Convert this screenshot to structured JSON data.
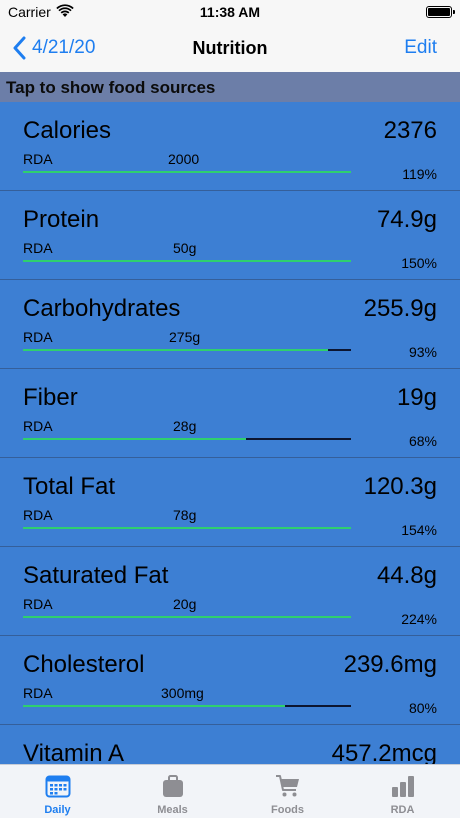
{
  "status_bar": {
    "carrier": "Carrier",
    "time": "11:38 AM"
  },
  "nav": {
    "back_label": "4/21/20",
    "title": "Nutrition",
    "edit_label": "Edit"
  },
  "section_header": "Tap to show food sources",
  "colors": {
    "accent": "#1e7ef0",
    "row_background": "#3d7fd3",
    "progress_fill": "#2fd06e",
    "progress_track": "#0c1530"
  },
  "nutrients": [
    {
      "name": "Calories",
      "amount": "2376",
      "rda_label": "RDA",
      "rda_value": "2000",
      "percent_label": "119%",
      "progress": 1.0
    },
    {
      "name": "Protein",
      "amount": "74.9g",
      "rda_label": "RDA",
      "rda_value": "50g",
      "percent_label": "150%",
      "progress": 1.0
    },
    {
      "name": "Carbohydrates",
      "amount": "255.9g",
      "rda_label": "RDA",
      "rda_value": "275g",
      "percent_label": "93%",
      "progress": 0.93
    },
    {
      "name": "Fiber",
      "amount": "19g",
      "rda_label": "RDA",
      "rda_value": "28g",
      "percent_label": "68%",
      "progress": 0.68
    },
    {
      "name": "Total Fat",
      "amount": "120.3g",
      "rda_label": "RDA",
      "rda_value": "78g",
      "percent_label": "154%",
      "progress": 1.0
    },
    {
      "name": "Saturated Fat",
      "amount": "44.8g",
      "rda_label": "RDA",
      "rda_value": "20g",
      "percent_label": "224%",
      "progress": 1.0
    },
    {
      "name": "Cholesterol",
      "amount": "239.6mg",
      "rda_label": "RDA",
      "rda_value": "300mg",
      "percent_label": "80%",
      "progress": 0.8
    },
    {
      "name": "Vitamin A",
      "amount": "457.2mcg",
      "rda_label": "",
      "rda_value": "",
      "percent_label": "",
      "progress": null
    }
  ],
  "tabs": [
    {
      "label": "Daily",
      "icon": "calendar-icon",
      "active": true
    },
    {
      "label": "Meals",
      "icon": "bag-icon",
      "active": false
    },
    {
      "label": "Foods",
      "icon": "cart-icon",
      "active": false
    },
    {
      "label": "RDA",
      "icon": "bar-chart-icon",
      "active": false
    }
  ]
}
